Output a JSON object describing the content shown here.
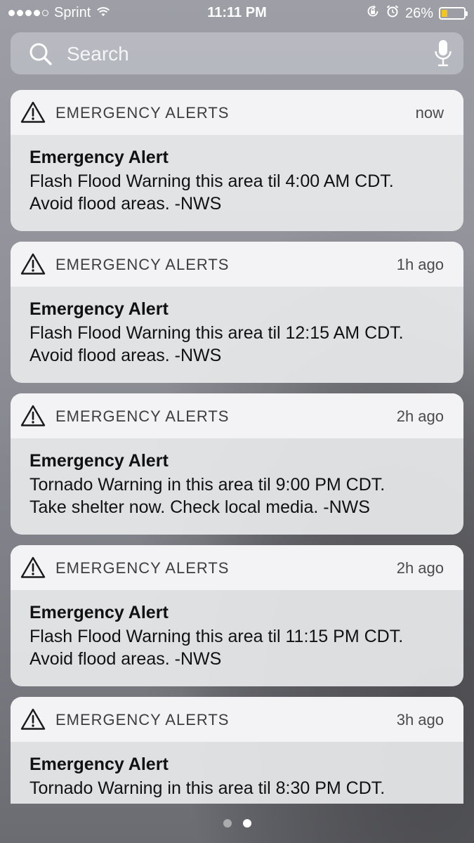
{
  "status_bar": {
    "carrier": "Sprint",
    "time": "11:11 PM",
    "battery_percent": "26%",
    "battery_level": 0.26,
    "battery_color": "#f5c518",
    "signal_bars_filled": 4,
    "icons": [
      "wifi-icon",
      "orientation-lock-icon",
      "alarm-icon",
      "battery-icon"
    ]
  },
  "search": {
    "placeholder": "Search",
    "icons": [
      "search-icon",
      "microphone-icon"
    ]
  },
  "notifications": [
    {
      "app": "EMERGENCY ALERTS",
      "time": "now",
      "title": "Emergency Alert",
      "line1": "Flash Flood Warning this area til 4:00 AM CDT.",
      "line2": "Avoid flood areas. -NWS",
      "icon": "warning-icon"
    },
    {
      "app": "EMERGENCY ALERTS",
      "time": "1h ago",
      "title": "Emergency Alert",
      "line1": "Flash Flood Warning this area til 12:15 AM CDT.",
      "line2": "Avoid flood areas. -NWS",
      "icon": "warning-icon"
    },
    {
      "app": "EMERGENCY ALERTS",
      "time": "2h ago",
      "title": "Emergency Alert",
      "line1": "Tornado Warning in this area til 9:00 PM CDT.",
      "line2": "Take shelter now. Check local media. -NWS",
      "icon": "warning-icon"
    },
    {
      "app": "EMERGENCY ALERTS",
      "time": "2h ago",
      "title": "Emergency Alert",
      "line1": "Flash Flood Warning this area til 11:15 PM CDT.",
      "line2": "Avoid flood areas. -NWS",
      "icon": "warning-icon"
    },
    {
      "app": "EMERGENCY ALERTS",
      "time": "3h ago",
      "title": "Emergency Alert",
      "line1": "Tornado Warning in this area til 8:30 PM CDT.",
      "icon": "warning-icon"
    }
  ],
  "pagination": {
    "pages": 2,
    "current_page": 2
  }
}
